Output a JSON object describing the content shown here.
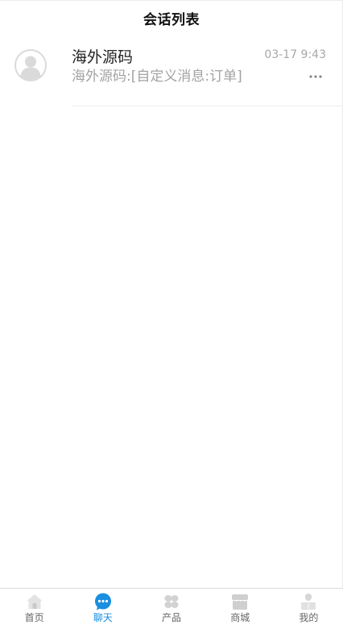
{
  "header": {
    "title": "会话列表"
  },
  "conversations": [
    {
      "name": "海外源码",
      "time": "03-17 9:43",
      "preview": "海外源码:[自定义消息:订单]",
      "avatar_icon": "default-user-avatar-icon",
      "more_icon": "ellipsis-icon"
    }
  ],
  "tabbar": {
    "active_color": "#1a8ee0",
    "inactive_color": "#cccccc",
    "items": [
      {
        "label": "首页",
        "icon": "home-icon",
        "active": false
      },
      {
        "label": "聊天",
        "icon": "chat-icon",
        "active": true
      },
      {
        "label": "产品",
        "icon": "product-icon",
        "active": false
      },
      {
        "label": "商城",
        "icon": "store-icon",
        "active": false
      },
      {
        "label": "我的",
        "icon": "profile-icon",
        "active": false
      }
    ]
  }
}
